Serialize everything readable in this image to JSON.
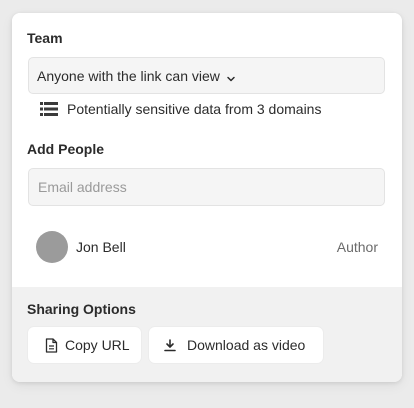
{
  "team": {
    "heading": "Team",
    "access_value": "Anyone with the link can view",
    "sensitive_note": "Potentially sensitive data from 3 domains",
    "access_icon": "chevron-down-icon",
    "note_icon": "server-stack-icon"
  },
  "add_people": {
    "heading": "Add People",
    "email_placeholder": "Email address",
    "email_value": ""
  },
  "people": [
    {
      "name": "Jon Bell",
      "role": "Author"
    }
  ],
  "sharing": {
    "heading": "Sharing Options",
    "copy_url_label": "Copy URL",
    "copy_url_icon": "document-icon",
    "download_label": "Download as video",
    "download_icon": "download-icon"
  },
  "colors": {
    "background": "#ebebeb",
    "card": "#ffffff",
    "footer": "#f1f1f1",
    "field": "#f5f5f5",
    "avatar": "#9b9b9b"
  }
}
